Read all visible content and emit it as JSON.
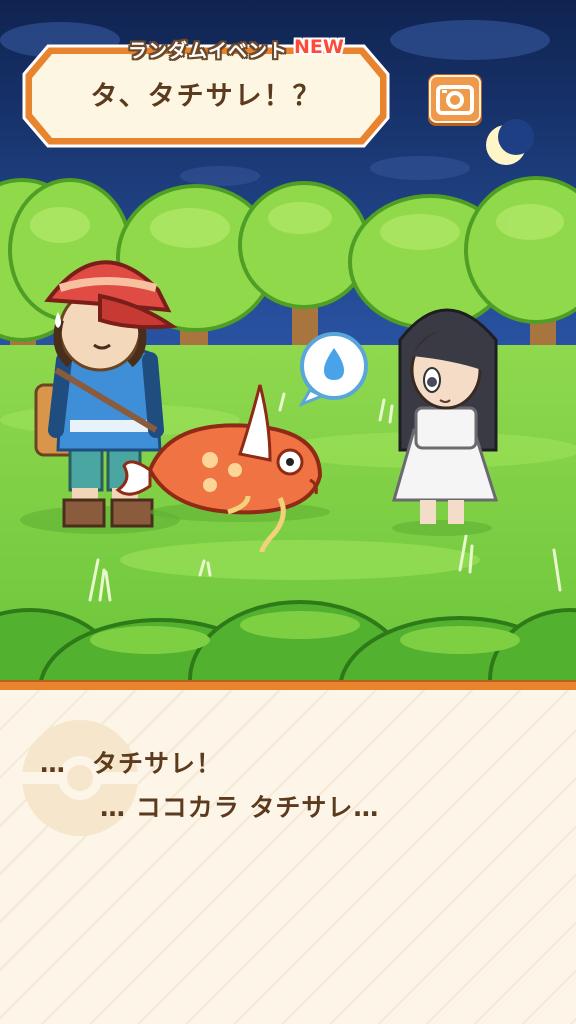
{
  "event": {
    "label": "ランダムイベント",
    "badge": "NEW",
    "title": "タ、タチサレ！？"
  },
  "toolbar": {
    "camera_icon": "camera-icon"
  },
  "scene": {
    "characters": [
      "trainer",
      "magikarp",
      "ghost-girl"
    ],
    "emote_icon": "sweat-drop-icon"
  },
  "dialogue": {
    "line1": "…　タチサレ！",
    "line2": "… ココカラ タチサレ…"
  },
  "colors": {
    "sky": "#1d3b7c",
    "grass": "#7fcf43",
    "accent": "#e8832e",
    "text": "#5b3a1e"
  }
}
